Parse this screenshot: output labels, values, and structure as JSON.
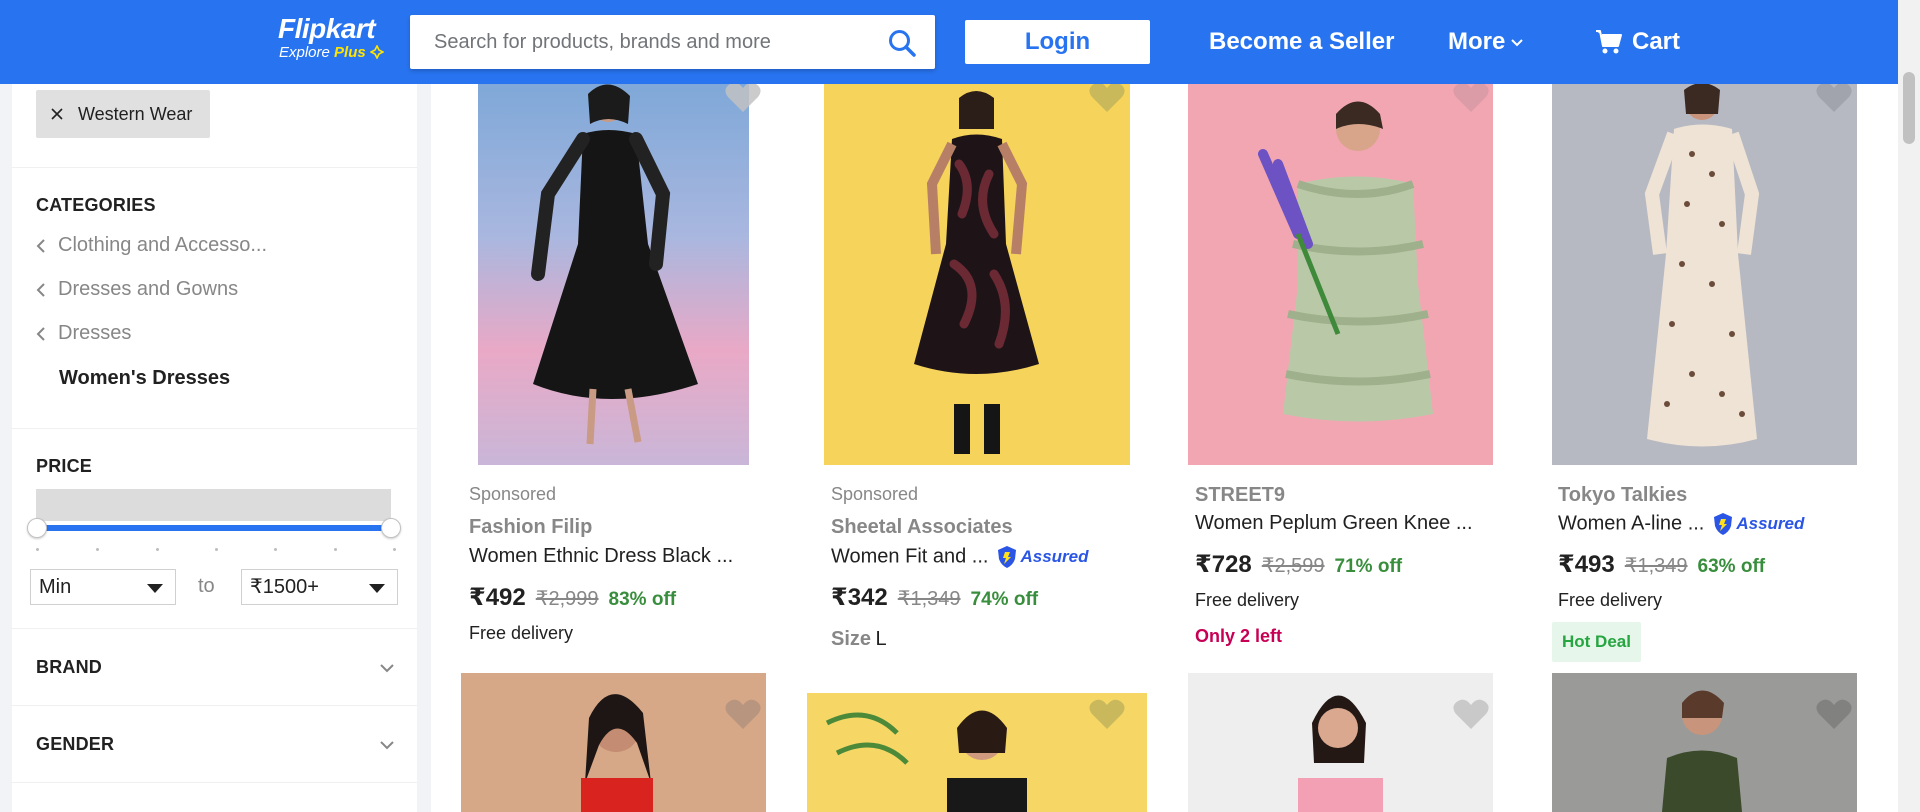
{
  "header": {
    "logo_text": "Flipkart",
    "logo_explore": "Explore",
    "logo_plus": "Plus",
    "search_placeholder": "Search for products, brands and more",
    "login_label": "Login",
    "become_seller": "Become a Seller",
    "more": "More",
    "cart": "Cart"
  },
  "colors": {
    "brand": "#2874f0",
    "discount": "#388e3c",
    "logo_plus": "#ffe500"
  },
  "sidebar": {
    "active_filter": "Western Wear",
    "categories_title": "CATEGORIES",
    "categories": [
      {
        "label": "Clothing and Accesso..."
      },
      {
        "label": "Dresses and Gowns"
      },
      {
        "label": "Dresses"
      }
    ],
    "current_category": "Women's Dresses",
    "price_title": "PRICE",
    "price_min": "Min",
    "price_to": "to",
    "price_max": "₹1500+",
    "brand_title": "BRAND",
    "gender_title": "GENDER"
  },
  "products": [
    {
      "sponsored": "Sponsored",
      "brand": "Fashion Filip",
      "title": "Women Ethnic Dress Black ...",
      "price": "₹492",
      "mrp": "₹2,999",
      "off": "83% off",
      "delivery": "Free delivery"
    },
    {
      "sponsored": "Sponsored",
      "brand": "Sheetal Associates",
      "title": "Women Fit and ...",
      "assured": "Assured",
      "price": "₹342",
      "mrp": "₹1,349",
      "off": "74% off",
      "size_label": "Size",
      "size_value": "L"
    },
    {
      "brand": "STREET9",
      "title": "Women Peplum Green Knee ...",
      "price": "₹728",
      "mrp": "₹2,599",
      "off": "71% off",
      "delivery": "Free delivery",
      "stock": "Only 2 left"
    },
    {
      "brand": "Tokyo Talkies",
      "title": "Women A-line ...",
      "assured": "Assured",
      "price": "₹493",
      "mrp": "₹1,349",
      "off": "63% off",
      "delivery": "Free delivery",
      "badge": "Hot Deal"
    }
  ]
}
